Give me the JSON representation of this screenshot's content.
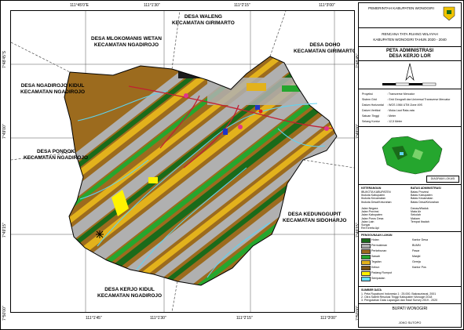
{
  "coords": {
    "top": [
      "111°45'0\"E",
      "111°1'30\"",
      "111°2'15\"",
      "111°3'00\""
    ],
    "bottom": [
      "111°1'45\"",
      "111°1'30\"",
      "111°2'15\"",
      "111°3'00\""
    ],
    "left": [
      "7°48'45\"S",
      "7°49'00\"",
      "7°49'15\"",
      "7°50'00\""
    ],
    "right": [
      "7°48'45\"",
      "7°49'00\"",
      "7°49'15\"",
      "7°50'00\""
    ]
  },
  "regions": [
    {
      "name": "DESA WALENG",
      "district": "KECAMATAN GIRIMARTO"
    },
    {
      "name": "DESA MLOKOMANIS WETAN",
      "district": "KECAMATAN NGADIROJO"
    },
    {
      "name": "DESA DOHO",
      "district": "KECAMATAN GIRIMARTO"
    },
    {
      "name": "DESA NGADIROJO KIDUL",
      "district": "KECAMATAN NGADIROJO"
    },
    {
      "name": "DESA PONDOK",
      "district": "KECAMATAN NGADIROJO"
    },
    {
      "name": "DESA KEDUNGGUPIT",
      "district": "KECAMATAN SIDOHARJO"
    },
    {
      "name": "DESA KERJO KIDUL",
      "district": "KECAMATAN NGADIROJO"
    }
  ],
  "sidebar": {
    "header": "PEMERINTAH KABUPATEN WONOGIRI",
    "plan_title": "RENCANA TATA RUANG WILAYAH",
    "plan_subtitle": "KABUPATEN WONOGIRI TAHUN 2020 - 2040",
    "map_title": "PETA ADMINISTRASI",
    "map_subtitle": "DESA KERJO LOR",
    "info_lines": [
      {
        "k": "Proyeksi",
        "v": ": Transverse Mercator"
      },
      {
        "k": "Sistem Grid",
        "v": ": Grid Geografi dan Universal Transverse Mercator"
      },
      {
        "k": "Datum Horizontal",
        "v": ": WGS 1984 UTM Zone 49S"
      },
      {
        "k": "Datum Vertikal",
        "v": ": Muka Laut Rata-rata"
      },
      {
        "k": "Satuan Tinggi",
        "v": ": Meter"
      },
      {
        "k": "Selang Kontur",
        "v": ": 12,5 Meter"
      }
    ],
    "location_label": "DIAGRAM LOKASI",
    "legend_title_left": "KETERANGAN",
    "legend_title_right": "BATAS ADMINISTRASI",
    "legend_left": [
      "IBUKOTA KABUPATEN",
      "Ibukota Kabupaten",
      "Ibukota Kecamatan",
      "Ibukota Desa/Kelurahan",
      "",
      "Jalan Negara",
      "Jalan Provinsi",
      "Jalan Kabupaten",
      "Jalan Poros Desa",
      "Jalan Lain",
      "Sungai",
      "Rel Kereta Api"
    ],
    "legend_right": [
      "Batas Provinsi",
      "Batas Kabupaten",
      "Batas Kecamatan",
      "Batas Desa/Kelurahan",
      "",
      "Danau/Waduk",
      "Mata Air",
      "Sekolah",
      "Makam",
      "Tempat Ibadah"
    ],
    "landuse_title": "PENGGUNAAN LAHAN",
    "landuse": [
      {
        "label": "Hutan",
        "color": "#1a6b1a"
      },
      {
        "label": "Permukiman",
        "color": "#b0b0b0"
      },
      {
        "label": "Perkebunan",
        "color": "#9c6b1e"
      },
      {
        "label": "Sawah",
        "color": "#25a62e"
      },
      {
        "label": "Tegalan",
        "color": "#e3b21c"
      },
      {
        "label": "Kebun",
        "color": "#7a5316"
      },
      {
        "label": "Padang Rumput",
        "color": "#fff200"
      },
      {
        "label": "Sempadan",
        "color": "#66e0ff"
      }
    ],
    "points_right": [
      "Kantor Desa",
      "BUMN",
      "Pasar",
      "Masjid",
      "Gereja",
      "Kantor Pos"
    ],
    "source_title": "SUMBER DATA",
    "source_lines": [
      "1. Peta Rupabumi Indonesia 1 : 25.000, Bakosurtanal, 2001",
      "2. Citra Satelit Resolusi Tinggi Kabupaten Wonogiri 2018",
      "3. Pengolahan Data Lapangan dan Hasil Survey 2019 - 2020"
    ],
    "bupati_label": "BUPATI WONOGIRI",
    "bupati_name": "JOKO SUTOPO"
  },
  "colors": {
    "hutan": "#1a6b1a",
    "permukiman": "#b0b0b0",
    "perkebunan": "#9c6b1e",
    "sawah": "#25a62e",
    "tegalan": "#e3b21c",
    "river": "#5fd3f0",
    "road": "#c22032"
  }
}
